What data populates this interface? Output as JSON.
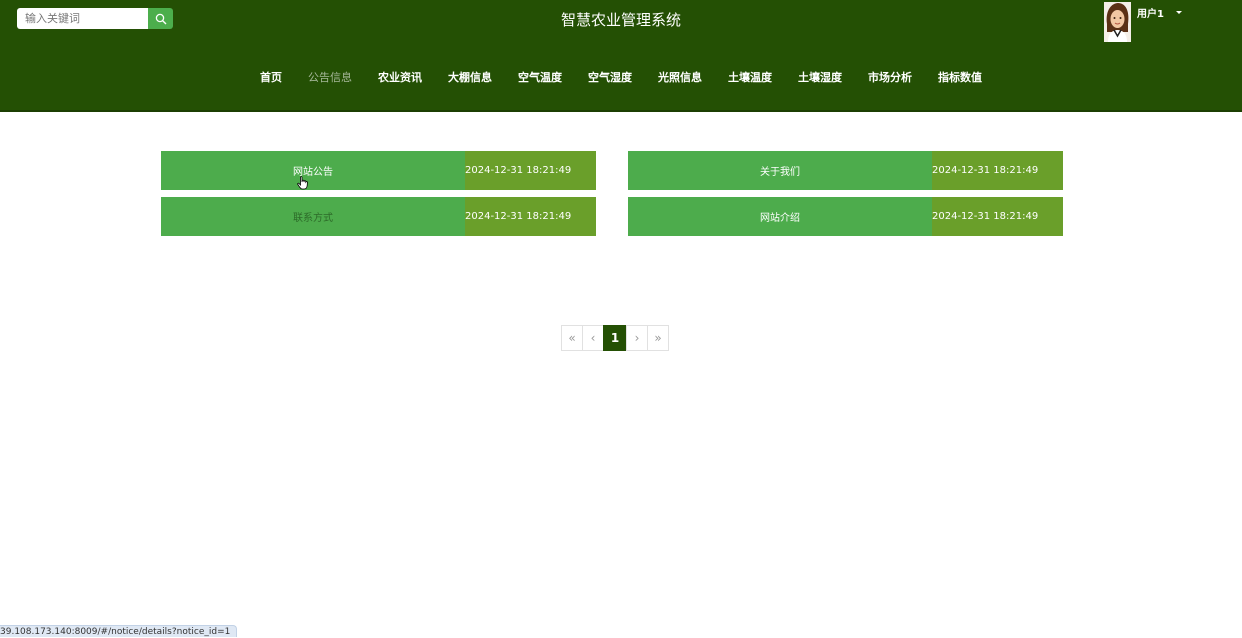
{
  "header": {
    "search_placeholder": "输入关键词",
    "search_icon": "search-icon",
    "title": "智慧农业管理系统",
    "user_name": "用户1"
  },
  "nav": [
    {
      "label": "首页",
      "active": false
    },
    {
      "label": "公告信息",
      "active": true
    },
    {
      "label": "农业资讯",
      "active": false
    },
    {
      "label": "大棚信息",
      "active": false
    },
    {
      "label": "空气温度",
      "active": false
    },
    {
      "label": "空气湿度",
      "active": false
    },
    {
      "label": "光照信息",
      "active": false
    },
    {
      "label": "土壤温度",
      "active": false
    },
    {
      "label": "土壤湿度",
      "active": false
    },
    {
      "label": "市场分析",
      "active": false
    },
    {
      "label": "指标数值",
      "active": false
    }
  ],
  "notices": [
    {
      "title": "网站公告",
      "date": "2024-12-31 18:21:49"
    },
    {
      "title": "关于我们",
      "date": "2024-12-31 18:21:49"
    },
    {
      "title": "联系方式",
      "date": "2024-12-31 18:21:49"
    },
    {
      "title": "网站介绍",
      "date": "2024-12-31 18:21:49"
    }
  ],
  "pagination": {
    "first": "«",
    "prev": "‹",
    "current": "1",
    "next": "›",
    "last": "»"
  },
  "status_url": "39.108.173.140:8009/#/notice/details?notice_id=1",
  "colors": {
    "header_bg": "#245004",
    "notice_name_bg": "#4dac4c",
    "notice_date_bg": "#6a9f2a",
    "search_button": "#4cae4c"
  }
}
